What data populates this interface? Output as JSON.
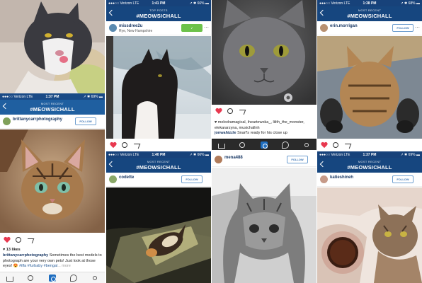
{
  "colors": {
    "ig_blue": "#1f5fa0",
    "heart_red": "#e8384f",
    "following_green": "#6cc24a"
  },
  "icons": [
    "back-arrow-icon",
    "heart-icon",
    "comment-icon",
    "share-icon",
    "home-icon",
    "search-icon",
    "camera-icon",
    "activity-icon",
    "profile-icon",
    "more-icon"
  ],
  "panels": {
    "p1": {
      "status": {
        "carrier": "●●●○○ Verizon  LTE",
        "time": "1:37 PM",
        "battery": "↗ ✱ 69% ▬"
      },
      "header": {
        "sub": "MOST RECENT",
        "tag": "#MEOWSICHALL"
      },
      "user": "brittanycarrphotography",
      "follow": "FOLLOW",
      "likes": "♥ 13 likes",
      "caption_user": "brittanycarrphotography",
      "caption_text": " Sometimes the best models to photograph are your very own pets! Just look at those eyes! 😍 ",
      "caption_tags": "#ilfa #furbaby #bengal",
      "caption_more": "... more"
    },
    "p2": {
      "status": {
        "carrier": "●●●○○ Verizon  LTE",
        "time": "1:41 PM",
        "battery": "↗ ✱ 66% ▬"
      },
      "header": {
        "sub": "TOP POSTS",
        "tag": "#MEOWSICHALL"
      },
      "user": "missdree2u",
      "location": "Rye, New Hampshire",
      "follow": "✓ FOLLOWING"
    },
    "p3": {
      "status": {
        "carrier": "●●●○○ Verizon  LTE",
        "time": "1:40 PM",
        "battery": "↗ ✱ 66% ▬"
      },
      "header": {
        "sub": "MOST RECENT",
        "tag": "#MEOWSICHALL"
      },
      "user": "codette",
      "follow": "FOLLOW"
    },
    "p4": {
      "likes_line": "♥ melodramagical, iheartewoka_, lilith_the_monster, elekararzyna, musichallnh",
      "caption_user": "jonwahizzle",
      "caption_text": " Snarf's ready for his close up"
    },
    "p5": {
      "user": "mena488",
      "follow": "FOLLOW"
    },
    "p6": {
      "status": {
        "carrier": "●●●○○ Verizon  LTE",
        "time": "1:38 PM",
        "battery": "↗ ✱ 68% ▬"
      },
      "header": {
        "sub": "MOST RECENT",
        "tag": "#MEOWSICHALL"
      },
      "user": "erin.morrigan",
      "follow": "FOLLOW"
    },
    "p7": {
      "status": {
        "carrier": "●●●○○ Verizon  LTE",
        "time": "1:37 PM",
        "battery": "↗ ✱ 69% ▬"
      },
      "header": {
        "sub": "MOST RECENT",
        "tag": "#MEOWSICHALL"
      },
      "user": "katieshineh",
      "follow": "FOLLOW"
    }
  }
}
